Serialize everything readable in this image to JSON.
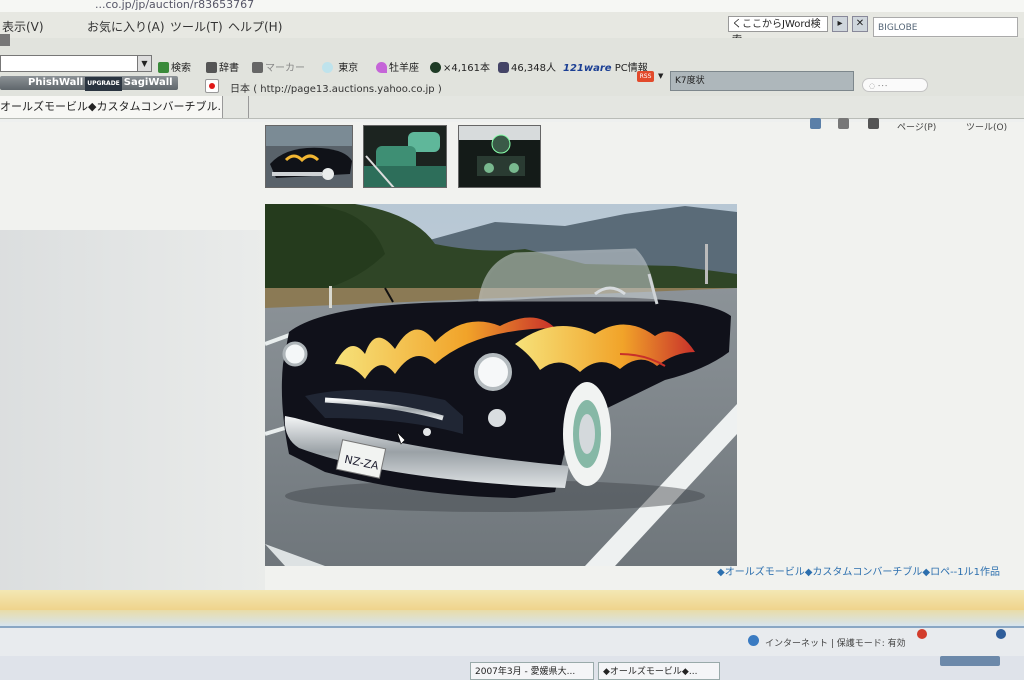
{
  "address": {
    "url": "...co.jp/jp/auction/r83653767"
  },
  "menu": [
    "表示(V)",
    "お気に入り(A)",
    "ツール(T)",
    "ヘルプ(H)"
  ],
  "search": {
    "value": "くここからJWord検索",
    "provider": "BIGLOBE"
  },
  "toolbar": {
    "search_label": "検索",
    "dictionary_label": "辞書",
    "marker_label": "マーカー",
    "weather_city": "東京",
    "horoscope": "牡羊座",
    "count_a": "×4,161本",
    "count_b": "46,348人",
    "brand": "121ware",
    "pc_info": "PC情報",
    "rss": "RSS",
    "address_field": "K7度状"
  },
  "phishwall": {
    "label": "PhishWall",
    "upgrade": "UPGRADE",
    "product": "SagiWall"
  },
  "domain_info": {
    "country": "日本",
    "url": "( http://page13.auctions.yahoo.co.jp )"
  },
  "tab": {
    "title": "オールズモービル◆カスタムコンバーチブル..."
  },
  "commandbar": {
    "page": "ページ(P)",
    "tools": "ツール(O)"
  },
  "breadcrumb": "◆オールズモービル◆カスタムコンバーチブル◆ロペ--1ル1作品",
  "status": {
    "zone": "インターネット | 保護モード: 有効"
  },
  "taskbar": {
    "item1": "2007年3月 - 愛媛県大...",
    "item2": "◆オールズモービル◆..."
  },
  "photo": {
    "plate": "NZ-ZA"
  }
}
